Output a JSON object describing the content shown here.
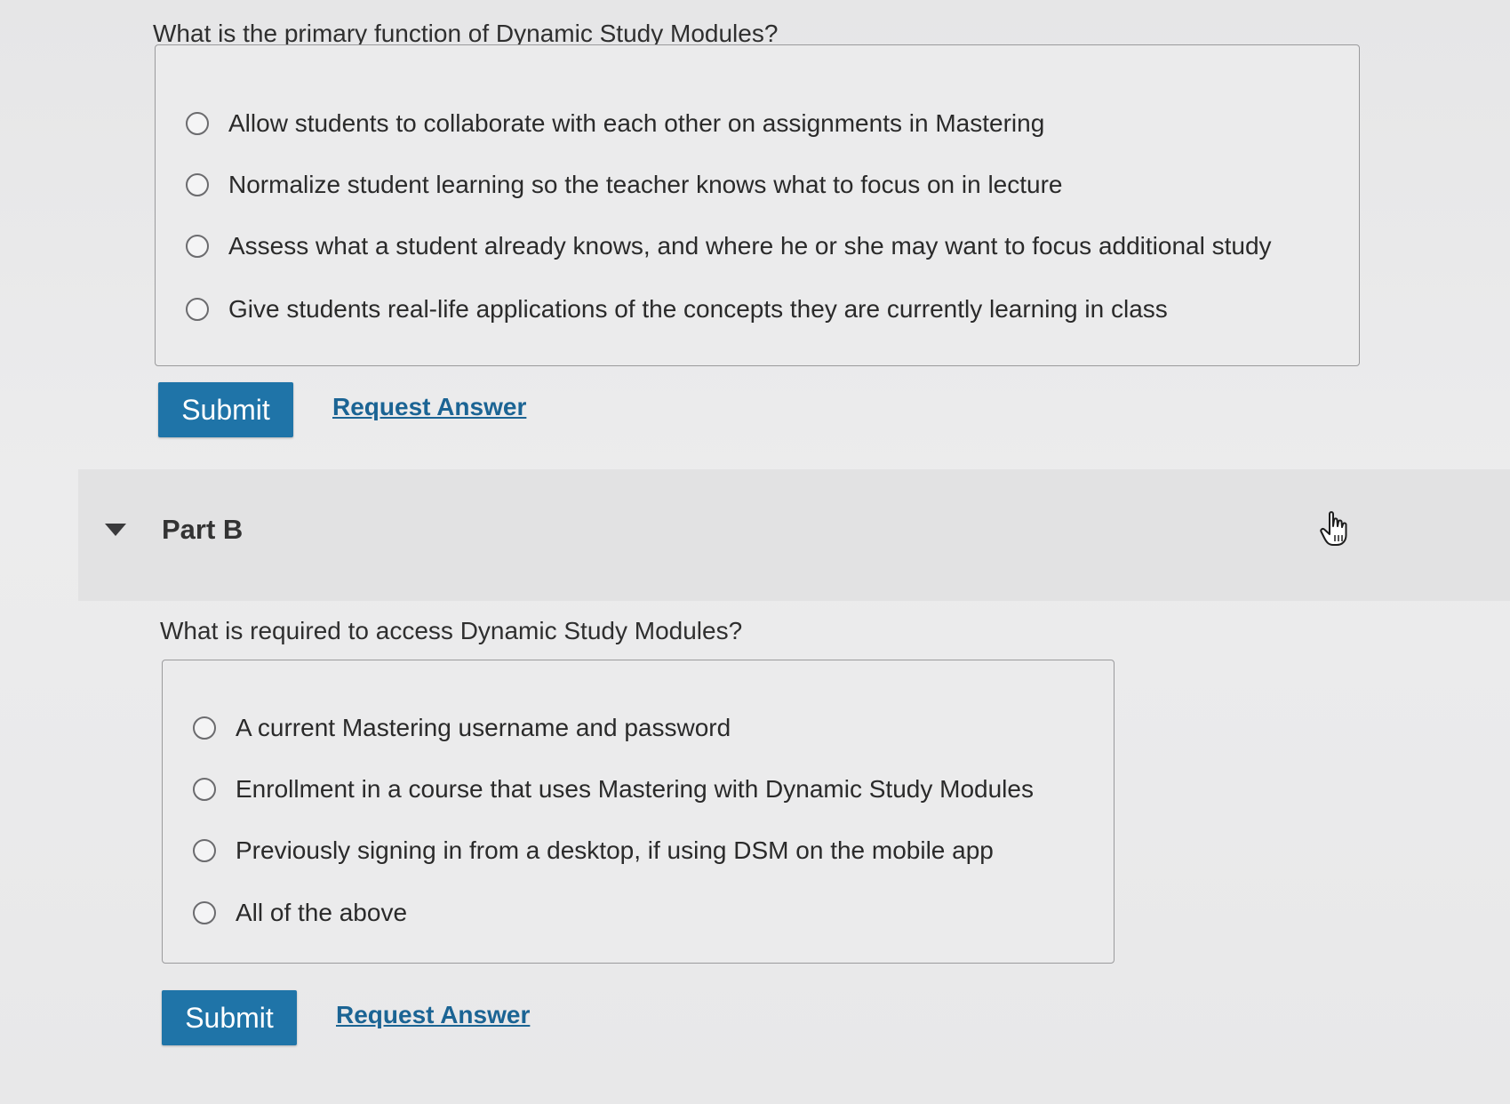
{
  "partA": {
    "question": "What is the primary function of Dynamic Study Modules?",
    "options": [
      "Allow students to collaborate with each other on assignments in Mastering",
      "Normalize student learning so the teacher knows what to focus on in lecture",
      "Assess what a student already knows, and where he or she may want to focus additional study",
      "Give students real-life applications of the concepts they are currently learning in class"
    ],
    "submit_label": "Submit",
    "request_label": "Request Answer"
  },
  "partB": {
    "title": "Part B",
    "question": "What is required to access Dynamic Study Modules?",
    "options": [
      "A current Mastering username and password",
      "Enrollment in a course that uses Mastering with Dynamic Study Modules",
      "Previously signing in from a desktop, if using DSM on the mobile app",
      "All of the above"
    ],
    "submit_label": "Submit",
    "request_label": "Request Answer"
  },
  "icons": {
    "collapse": "caret-down-icon",
    "pointer": "hand-pointer-icon",
    "radio": "radio-empty-icon"
  },
  "colors": {
    "submit_bg": "#1f74a8",
    "link": "#1b6494"
  }
}
